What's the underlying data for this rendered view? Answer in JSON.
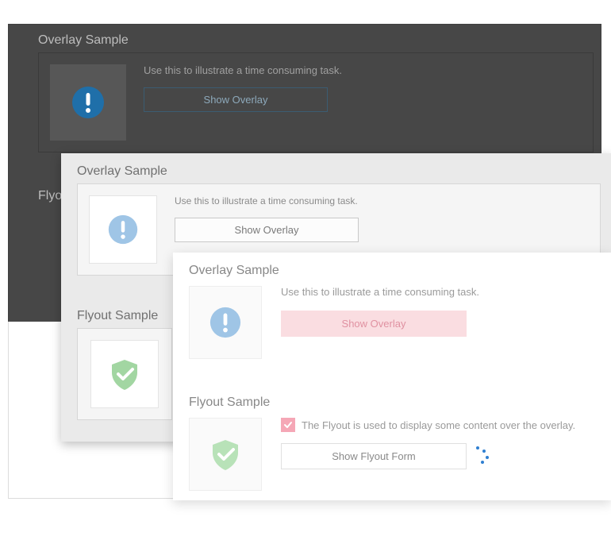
{
  "outer": {
    "dark": {
      "overlay_title": "Overlay Sample",
      "overlay_desc": "Use this to illustrate a time consuming task.",
      "overlay_button": "Show Overlay",
      "flyout_title": "Flyout Sample"
    }
  },
  "gray": {
    "overlay_title": "Overlay Sample",
    "overlay_desc": "Use this to illustrate a time consuming task.",
    "overlay_button": "Show Overlay",
    "flyout_title": "Flyout Sample"
  },
  "white": {
    "overlay_title": "Overlay Sample",
    "overlay_desc": "Use this to illustrate a time consuming task.",
    "overlay_button": "Show Overlay",
    "flyout_title": "Flyout Sample",
    "flyout_checkbox_label": "The Flyout is used to display some content over the overlay.",
    "flyout_button": "Show Flyout Form"
  },
  "icons": {
    "exclamation": "exclamation-circle-icon",
    "shield": "shield-check-icon"
  },
  "colors": {
    "dark_bg": "#1e1e1e",
    "gray_bg": "#eaeaea",
    "white_bg": "#ffffff",
    "pink_button": "#fadde1",
    "pink_check": "#f5a7b6",
    "icon_blue_dark": "#1f6fa9",
    "icon_blue_light": "#9fc5e6",
    "shield_green": "#a2d6a2"
  }
}
